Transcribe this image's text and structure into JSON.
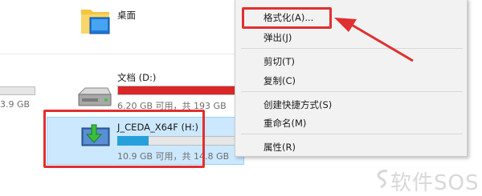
{
  "desktop": {
    "label": "桌面"
  },
  "left_drive": {
    "size_text": "3.9 GB"
  },
  "drive_d": {
    "label": "文档 (D:)",
    "size_text": "6.20 GB 可用，共 193 GB",
    "used_fraction": 0.97,
    "bar_color": "#da2626"
  },
  "usb_drive": {
    "label": "J_CEDA_X64F (H:)",
    "size_text": "10.9 GB 可用，共 14.8 GB",
    "used_fraction": 0.26,
    "bar_color": "#26a0da"
  },
  "context_menu": {
    "format": "格式化(A)...",
    "eject": "弹出(J)",
    "cut": "剪切(T)",
    "copy": "复制(C)",
    "create_shortcut": "创建快捷方式(S)",
    "rename": "重命名(M)",
    "properties": "属性(R)"
  },
  "highlight_color": "#e0302f",
  "watermark": {
    "text": "软件SOS",
    "icon": "swirl-logo-icon"
  },
  "icons": {
    "desktop": "desktop-folder-icon",
    "drive_d": "hard-drive-icon",
    "usb": "usb-drive-icon"
  }
}
